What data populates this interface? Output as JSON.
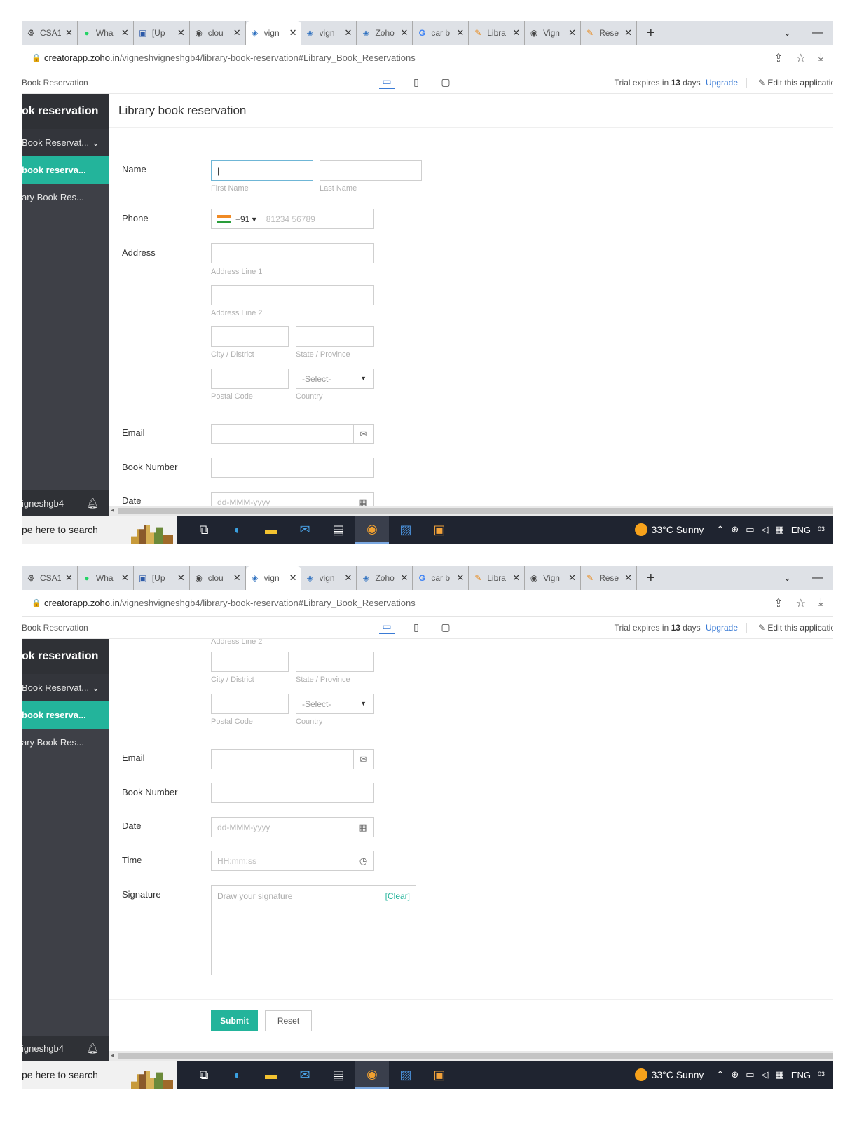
{
  "browser": {
    "tabs": [
      {
        "icon": "gear-icon",
        "glyph": "⚙",
        "label": "CSA1"
      },
      {
        "icon": "whatsapp-icon",
        "glyph": "●",
        "label": "Wha"
      },
      {
        "icon": "doc-icon",
        "glyph": "▣",
        "label": "[Up"
      },
      {
        "icon": "github-icon",
        "glyph": "◉",
        "label": "clou"
      },
      {
        "icon": "zoho-creator-icon",
        "glyph": "◈",
        "label": "vign",
        "active": true
      },
      {
        "icon": "zoho-creator-icon",
        "glyph": "◈",
        "label": "vign"
      },
      {
        "icon": "zoho-creator-icon",
        "glyph": "◈",
        "label": "Zoho"
      },
      {
        "icon": "google-icon",
        "glyph": "G",
        "label": "car b"
      },
      {
        "icon": "library-icon",
        "glyph": "✎",
        "label": "Libra"
      },
      {
        "icon": "github-icon",
        "glyph": "◉",
        "label": "Vign"
      },
      {
        "icon": "library-icon",
        "glyph": "✎",
        "label": "Rese"
      }
    ],
    "close_glyph": "✕",
    "new_tab": "+",
    "url_host": "creatorapp.zoho.in",
    "url_path": "/vigneshvigneshgb4/library-book-reservation#Library_Book_Reservations"
  },
  "app_header": {
    "title": "Book Reservation",
    "trial_prefix": "Trial expires in",
    "trial_days": "13",
    "trial_suffix": "days",
    "upgrade": "Upgrade",
    "edit": "Edit this application"
  },
  "sidebar": {
    "heading": "ok reservation",
    "group": "Book Reservat...",
    "selected": "book reserva...",
    "sub": "ary Book Res...",
    "user": "igneshgb4"
  },
  "form": {
    "title": "Library book reservation",
    "labels": {
      "name": "Name",
      "phone": "Phone",
      "address": "Address",
      "email": "Email",
      "book_number": "Book Number",
      "date": "Date",
      "time": "Time",
      "signature": "Signature"
    },
    "hints": {
      "first_name": "First Name",
      "last_name": "Last Name",
      "address_line_1": "Address Line 1",
      "address_line_2": "Address Line 2",
      "city": "City / District",
      "state": "State / Province",
      "postal": "Postal Code",
      "country": "Country"
    },
    "phone_code": "+91",
    "phone_placeholder": "81234 56789",
    "country_select": "-Select-",
    "date_placeholder": "dd-MMM-yyyy",
    "time_placeholder": "HH:mm:ss",
    "signature_placeholder": "Draw your signature",
    "signature_clear": "[Clear]",
    "submit": "Submit",
    "reset": "Reset"
  },
  "taskbar": {
    "search": "pe here to search",
    "weather": "33°C  Sunny",
    "lang": "ENG",
    "clock": "03"
  }
}
